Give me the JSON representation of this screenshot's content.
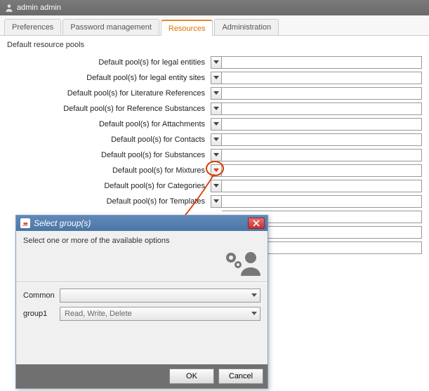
{
  "user_label": "admin admin",
  "tabs": {
    "preferences": "Preferences",
    "password": "Password management",
    "resources": "Resources",
    "administration": "Administration"
  },
  "section_title": "Default resource pools",
  "pool_labels": [
    "Default pool(s) for legal entities",
    "Default pool(s) for legal entity sites",
    "Default pool(s) for Literature References",
    "Default pool(s) for Reference Substances",
    "Default pool(s) for Attachments",
    "Default pool(s) for Contacts",
    "Default pool(s) for Substances",
    "Default pool(s) for Mixtures",
    "Default pool(s) for Categories",
    "Default pool(s) for Templates",
    "",
    "",
    ""
  ],
  "dialog": {
    "title": "Select group(s)",
    "hint": "Select one or more of the available options",
    "rows": {
      "common": {
        "label": "Common",
        "value": ""
      },
      "group1": {
        "label": "group1",
        "value": "Read, Write, Delete"
      }
    },
    "ok": "OK",
    "cancel": "Cancel"
  },
  "colors": {
    "accent": "#e38b2a",
    "annotation": "#d93a00"
  }
}
